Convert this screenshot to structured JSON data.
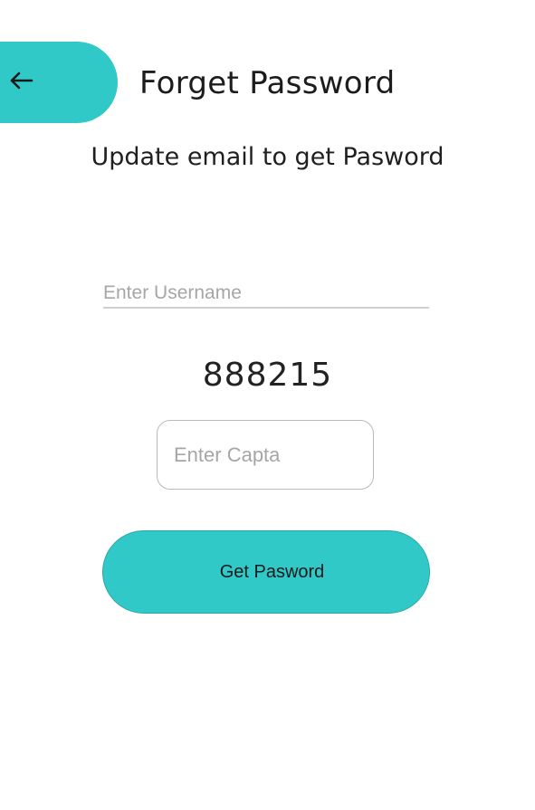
{
  "header": {
    "back_icon": "arrow-left-icon",
    "title": "Forget Password"
  },
  "subtitle": "Update email to get Pasword",
  "form": {
    "username_placeholder": "Enter Username",
    "username_value": "",
    "captcha_code": "888215",
    "captcha_placeholder": "Enter Capta",
    "captcha_value": "",
    "submit_label": "Get Pasword"
  },
  "colors": {
    "accent": "#31c8c8",
    "background": "#ffffff"
  }
}
